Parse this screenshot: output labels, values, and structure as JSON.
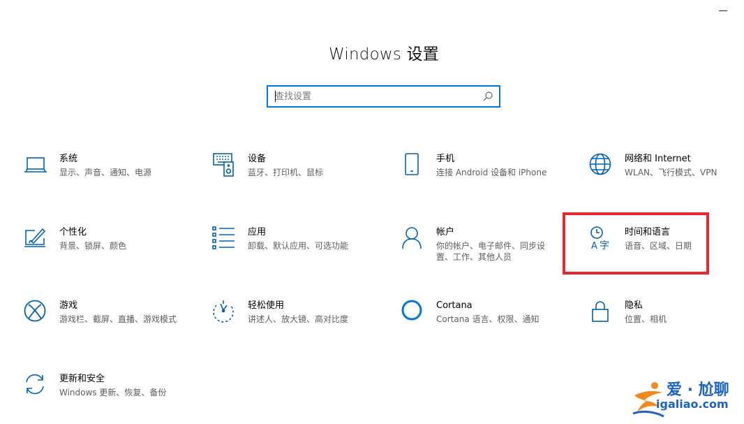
{
  "window": {
    "title": "Windows 设置",
    "minimize_icon": "minimize-icon"
  },
  "search": {
    "placeholder": "查找设置",
    "value": "",
    "icon": "search-icon"
  },
  "tiles": [
    {
      "name": "系统",
      "desc": "显示、声音、通知、电源",
      "icon": "laptop-icon"
    },
    {
      "name": "设备",
      "desc": "蓝牙、打印机、鼠标",
      "icon": "devices-icon"
    },
    {
      "name": "手机",
      "desc": "连接 Android 设备和 iPhone",
      "icon": "phone-icon"
    },
    {
      "name": "网络和 Internet",
      "desc": "WLAN、飞行模式、VPN",
      "icon": "globe-icon"
    },
    {
      "name": "个性化",
      "desc": "背景、锁屏、颜色",
      "icon": "personalization-icon"
    },
    {
      "name": "应用",
      "desc": "卸载、默认应用、可选功能",
      "icon": "apps-list-icon"
    },
    {
      "name": "帐户",
      "desc": "你的帐户、电子邮件、同步设置、工作、其他人员",
      "icon": "person-icon"
    },
    {
      "name": "时间和语言",
      "desc": "语音、区域、日期",
      "icon": "time-language-icon"
    },
    {
      "name": "游戏",
      "desc": "游戏栏、截屏、直播、游戏模式",
      "icon": "xbox-icon"
    },
    {
      "name": "轻松使用",
      "desc": "讲述人、放大镜、高对比度",
      "icon": "ease-of-access-icon"
    },
    {
      "name": "Cortana",
      "desc": "Cortana 语言、权限、通知",
      "icon": "cortana-icon"
    },
    {
      "name": "隐私",
      "desc": "位置、相机",
      "icon": "lock-icon"
    },
    {
      "name": "更新和安全",
      "desc": "Windows 更新、恢复、备份",
      "icon": "update-icon"
    }
  ],
  "colors": {
    "accent": "#0078d7",
    "highlight": "#e8282f",
    "watermark": "#1d62c6"
  },
  "watermark": {
    "brand": "爱 · 尬聊",
    "url": "igaliao.com"
  }
}
